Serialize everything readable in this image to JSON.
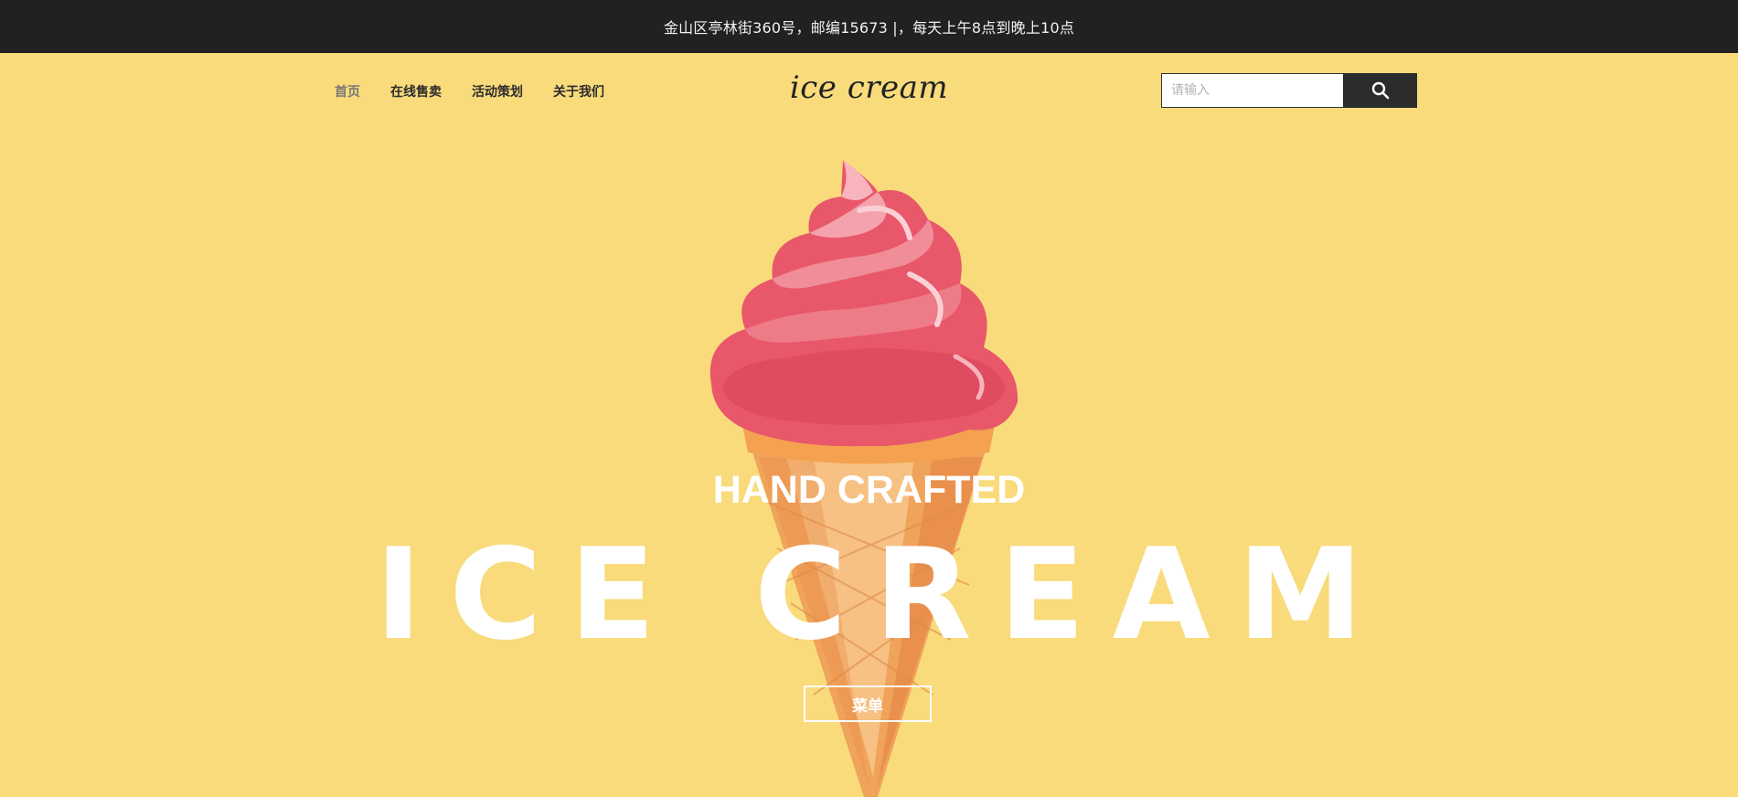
{
  "topbar": {
    "text": "金山区亭林街360号，邮编15673 |，每天上午8点到晚上10点"
  },
  "nav": {
    "items": [
      {
        "label": "首页",
        "active": true
      },
      {
        "label": "在线售卖",
        "active": false
      },
      {
        "label": "活动策划",
        "active": false
      },
      {
        "label": "关于我们",
        "active": false
      }
    ]
  },
  "logo": {
    "text": "ice cream"
  },
  "search": {
    "placeholder": "请输入",
    "value": "",
    "icon": "search-icon"
  },
  "hero": {
    "subtitle": "HAND CRAFTED",
    "title": "ICE CREAM",
    "button_label": "菜单",
    "illustration": "ice-cream-cone-illustration"
  },
  "colors": {
    "background": "#f9db7c",
    "topbar": "#212121",
    "search_button": "#2c2c2c",
    "text_white": "#ffffff"
  }
}
